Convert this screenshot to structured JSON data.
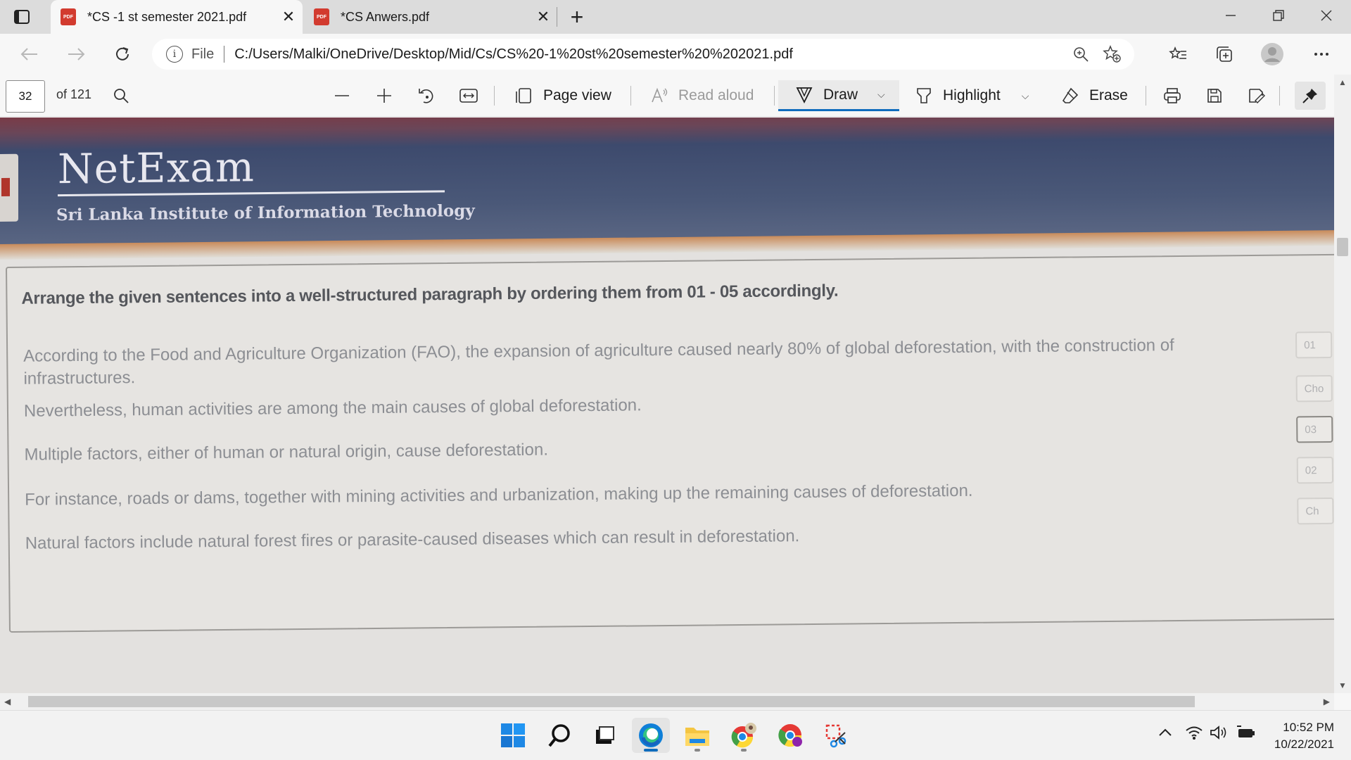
{
  "tabs": [
    {
      "title": "*CS -1 st semester 2021.pdf",
      "icon": "pdf-icon",
      "active": true
    },
    {
      "title": "*CS Anwers.pdf",
      "icon": "pdf-icon",
      "active": false
    }
  ],
  "pdf_icon_text": "PDF",
  "address": {
    "scheme_label": "File",
    "url": "C:/Users/Malki/OneDrive/Desktop/Mid/Cs/CS%20-1%20st%20semester%20%202021.pdf"
  },
  "pdf_toolbar": {
    "page_number": "32",
    "page_of": "of 121",
    "page_view": "Page view",
    "read_aloud": "Read aloud",
    "draw": "Draw",
    "highlight": "Highlight",
    "erase": "Erase"
  },
  "document": {
    "brand_title": "NetExam",
    "brand_subtitle": "Sri Lanka Institute of Information Technology",
    "instruction": "Arrange the given sentences into a well-structured paragraph by ordering them from 01 - 05 accordingly.",
    "sentences": [
      {
        "text": "According to the Food and Agriculture Organization (FAO), the expansion of agriculture caused nearly 80% of global deforestation, with the construction of infrastructures.",
        "answer": "01"
      },
      {
        "text": "Nevertheless, human activities are among the main causes of global deforestation.",
        "answer": "Cho"
      },
      {
        "text": "Multiple factors, either of human or natural origin, cause deforestation.",
        "answer": "03"
      },
      {
        "text": "For instance, roads or dams, together with mining activities and urbanization, making up the remaining causes of deforestation.",
        "answer": "02"
      },
      {
        "text": "Natural factors include natural forest fires or parasite-caused diseases which can result in deforestation.",
        "answer": "Ch"
      }
    ]
  },
  "taskbar": {
    "apps": [
      "windows-start",
      "search",
      "task-view",
      "edge",
      "file-explorer",
      "chrome-profile",
      "chrome",
      "snipping-tool"
    ],
    "time": "10:52 PM",
    "date": "10/22/2021"
  },
  "colors": {
    "accent": "#0f6cbd",
    "pdf_red": "#d23b2f",
    "header_blue": "#4a5878"
  }
}
